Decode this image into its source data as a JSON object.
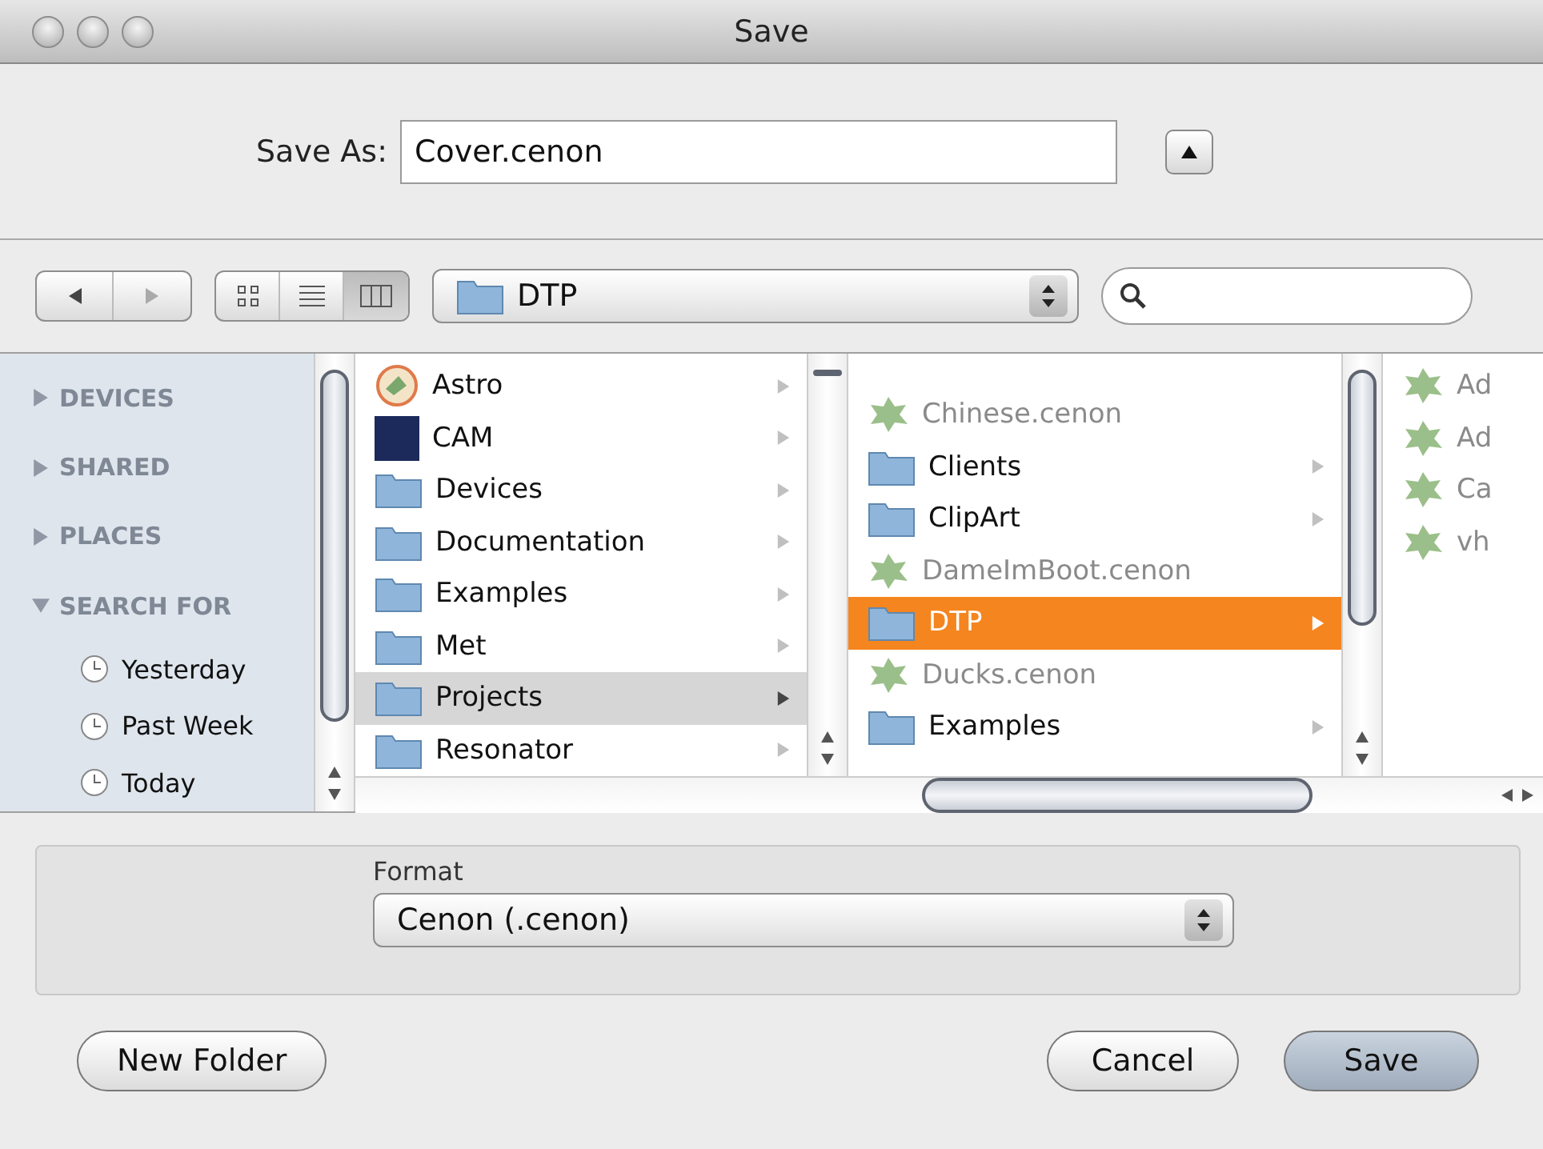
{
  "window": {
    "title": "Save"
  },
  "save_as": {
    "label": "Save As:",
    "value": "Cover.cenon",
    "expanded": false
  },
  "toolbar": {
    "view_modes": [
      {
        "kind": "icons",
        "selected": false
      },
      {
        "kind": "list",
        "selected": false
      },
      {
        "kind": "columns",
        "selected": true
      }
    ],
    "location": "DTP"
  },
  "sidebar": {
    "sections": [
      {
        "label": "DEVICES",
        "expanded": false
      },
      {
        "label": "SHARED",
        "expanded": false
      },
      {
        "label": "PLACES",
        "expanded": false
      },
      {
        "label": "SEARCH FOR",
        "expanded": true,
        "items": [
          {
            "label": "Yesterday"
          },
          {
            "label": "Past Week"
          },
          {
            "label": "Today"
          }
        ]
      }
    ]
  },
  "columns": [
    {
      "focused": false,
      "items": [
        {
          "name": "Astro",
          "kind": "app",
          "selected": false
        },
        {
          "name": "CAM",
          "kind": "image",
          "selected": false
        },
        {
          "name": "Devices",
          "kind": "folder",
          "selected": false
        },
        {
          "name": "Documentation",
          "kind": "folder",
          "selected": false
        },
        {
          "name": "Examples",
          "kind": "folder",
          "selected": false
        },
        {
          "name": "Met",
          "kind": "folder",
          "selected": false
        },
        {
          "name": "Projects",
          "kind": "folder",
          "selected": true
        },
        {
          "name": "Resonator",
          "kind": "folder",
          "selected": false
        }
      ]
    },
    {
      "focused": true,
      "items": [
        {
          "name": "Chinese.cenon",
          "kind": "file",
          "selected": false
        },
        {
          "name": "Clients",
          "kind": "folder",
          "selected": false
        },
        {
          "name": "ClipArt",
          "kind": "folder",
          "selected": false
        },
        {
          "name": "DameImBoot.cenon",
          "kind": "file",
          "selected": false
        },
        {
          "name": "DTP",
          "kind": "folder",
          "selected": true
        },
        {
          "name": "Ducks.cenon",
          "kind": "file",
          "selected": false
        },
        {
          "name": "Examples",
          "kind": "folder",
          "selected": false
        }
      ]
    },
    {
      "items": [
        {
          "name": "Ad",
          "kind": "file",
          "selected": false
        },
        {
          "name": "Ad",
          "kind": "file",
          "selected": false
        },
        {
          "name": "Ca",
          "kind": "file",
          "selected": false
        },
        {
          "name": "vh",
          "kind": "file",
          "selected": false
        }
      ]
    }
  ],
  "format": {
    "label": "Format",
    "value": "Cenon (.cenon)"
  },
  "buttons": [
    {
      "label": "New Folder",
      "kind": "normal"
    },
    {
      "label": "Cancel",
      "kind": "normal"
    },
    {
      "label": "Save",
      "kind": "default"
    }
  ]
}
